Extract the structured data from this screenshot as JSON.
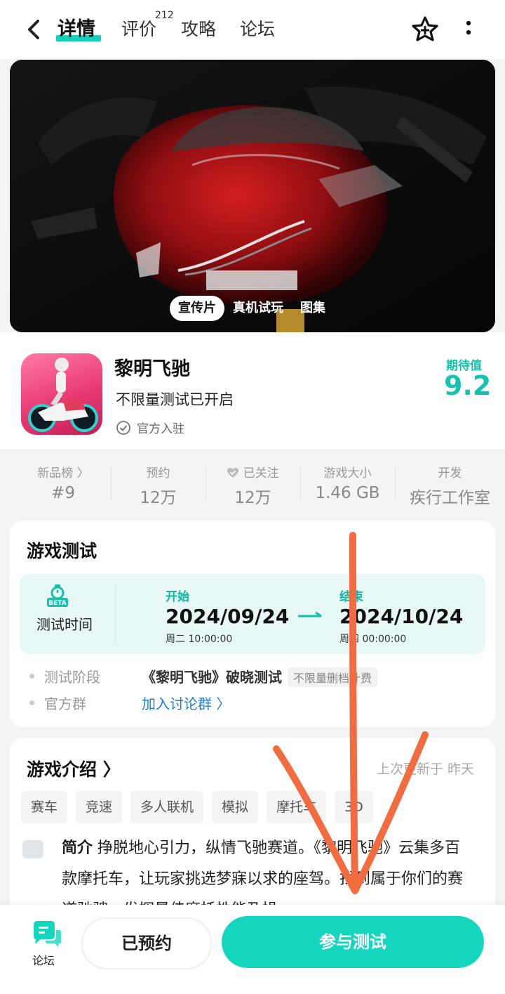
{
  "header": {
    "tabs": [
      {
        "label": "详情"
      },
      {
        "label": "评价"
      },
      {
        "label": "攻略"
      },
      {
        "label": "论坛"
      }
    ],
    "review_count": "212"
  },
  "hero": {
    "tabs": [
      "宣传片",
      "真机试玩",
      "图集"
    ]
  },
  "app": {
    "name": "黎明飞驰",
    "subtitle": "不限量测试已开启",
    "official": "官方入驻",
    "expectation_label": "期待值",
    "expectation_value": "9.2"
  },
  "stats": [
    {
      "label": "新品榜 〉",
      "value": "#9"
    },
    {
      "label": "预约",
      "value": "12万"
    },
    {
      "label": "已关注",
      "value": "12万"
    },
    {
      "label": "游戏大小",
      "value": "1.46 GB"
    },
    {
      "label": "开发",
      "value": "疾行工作室"
    }
  ],
  "test": {
    "title": "游戏测试",
    "time_label": "测试时间",
    "beta": "BETA",
    "start_label": "开始",
    "start_date": "2024/09/24",
    "start_time": "周二  10:00:00",
    "end_label": "结束",
    "end_date": "2024/10/24",
    "end_time": "周四  00:00:00",
    "stage_label": "测试阶段",
    "stage_value": "《黎明飞驰》破晓测试",
    "stage_badge": "不限量删档计费",
    "group_label": "官方群",
    "group_link": "加入讨论群 〉"
  },
  "intro": {
    "title": "游戏介绍 〉",
    "updated": "上次更新于  昨天",
    "tags": [
      "赛车",
      "竞速",
      "多人联机",
      "模拟",
      "摩托车",
      "3D"
    ],
    "text_bold": "简介",
    "text": " 挣脱地心引力，纵情飞驰赛道。《黎明飞驰》云集多百款摩托车，让玩家挑选梦寐以求的座驾。找到属于你们的赛道驰骋，发挥最佳摩托性能及操"
  },
  "bottom": {
    "forum_label": "论坛",
    "reserved_label": "已预约",
    "join_label": "参与测试"
  },
  "colors": {
    "accent": "#14d6bf",
    "link": "#1f7fcf",
    "annotation": "#f26c3f"
  }
}
